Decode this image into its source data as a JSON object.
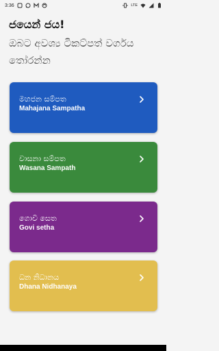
{
  "status_bar": {
    "time": "3:36",
    "network_label": "LTE",
    "icons_left": [
      "notification-app-icon",
      "whatsapp-icon",
      "gmail-icon",
      "sync-icon"
    ],
    "icons_right": [
      "vibrate-icon",
      "wifi-icon",
      "signal-icon",
      "battery-icon"
    ]
  },
  "header": {
    "greeting": "ජයෙන් ජය!",
    "subtitle": "ඔබට අවශ්‍ය ටිකට්පත් වර්ගය තෝරන්න"
  },
  "lotteries": [
    {
      "title": "මහජන සම්පත",
      "subtitle": "Mahajana Sampatha",
      "color": "#1f5bbf"
    },
    {
      "title": "වාසනා සම්පත",
      "subtitle": "Wasana Sampath",
      "color": "#3a8a3c"
    },
    {
      "title": "ගොවි සෙත",
      "subtitle": "Govi setha",
      "color": "#7b2a8c"
    },
    {
      "title": "ධන නිධානය",
      "subtitle": "Dhana Nidhanaya",
      "color": "#e2be4f"
    }
  ],
  "chevron_icon": "chevron-right-icon"
}
